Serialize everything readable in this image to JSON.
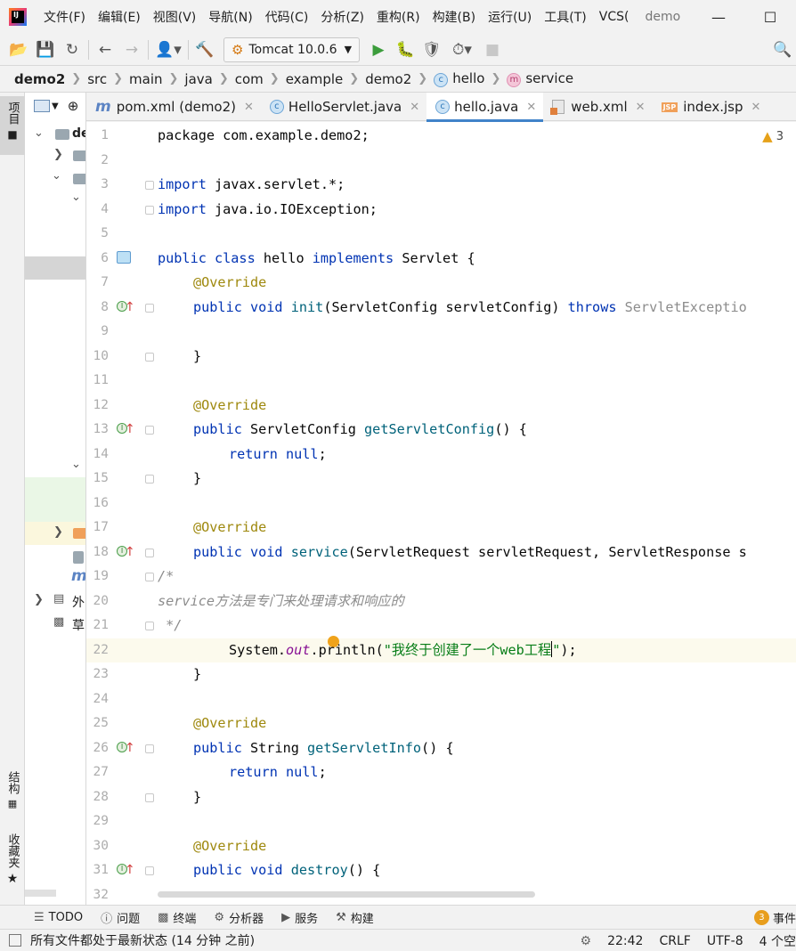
{
  "menu": {
    "items": [
      "文件(F)",
      "编辑(E)",
      "视图(V)",
      "导航(N)",
      "代码(C)",
      "分析(Z)",
      "重构(R)",
      "构建(B)",
      "运行(U)",
      "工具(T)",
      "VCS("
    ],
    "project_name": "demo",
    "minimize": "—",
    "maximize": "☐"
  },
  "toolbar": {
    "run_config": "Tomcat 10.0.6"
  },
  "breadcrumb": {
    "items": [
      "demo2",
      "src",
      "main",
      "java",
      "com",
      "example",
      "demo2",
      "hello",
      "service"
    ]
  },
  "left_strip": {
    "project_tab": "项目",
    "structure_tab": "结构",
    "favorites_tab": "收藏夹"
  },
  "project_panel": {
    "root_label": "de",
    "row_m": "m",
    "row_ext": "外",
    "row_scratch": "草"
  },
  "tabs": [
    {
      "label": "pom.xml (demo2)"
    },
    {
      "label": "HelloServlet.java"
    },
    {
      "label": "hello.java"
    },
    {
      "label": "web.xml"
    },
    {
      "label": "index.jsp"
    }
  ],
  "editor": {
    "warning_count": "3",
    "lines": {
      "l1": "package com.example.demo2;",
      "l3a": "import",
      "l3b": " javax.servlet.*;",
      "l4a": "import",
      "l4b": " java.io.IOException;",
      "l6a": "public class",
      "l6b": " hello ",
      "l6c": "implements",
      "l6d": " Servlet {",
      "ann": "@Override",
      "l8a": "public void ",
      "l8b": "init",
      "l8c": "(ServletConfig servletConfig) ",
      "l8d": "throws",
      "l8e": " ServletExceptio",
      "brace_close": "}",
      "l13a": "public",
      "l13b": " ServletConfig ",
      "l13c": "getServletConfig",
      "l13d": "() {",
      "l14a": "return null",
      "l14b": ";",
      "l18a": "public void ",
      "l18b": "service",
      "l18c": "(ServletRequest servletRequest, ServletResponse s",
      "l19": "/*",
      "l20": "service方法是专门来处理请求和响应的",
      "l21": " */",
      "l22a": "System.",
      "l22b": "out",
      "l22c": ".println(",
      "l22d": "\"我终于创建了一个web工程",
      "l22e": "\"",
      "l22f": ");",
      "l26a": "public",
      "l26b": " String ",
      "l26c": "getServletInfo",
      "l26d": "() {",
      "l31a": "public void ",
      "l31b": "destroy",
      "l31c": "() {"
    }
  },
  "bottom_tools": {
    "todo": "TODO",
    "problems": "问题",
    "terminal": "终端",
    "profiler": "分析器",
    "services": "服务",
    "build": "构建",
    "events_count": "3",
    "events": "事件"
  },
  "status": {
    "message": "所有文件都处于最新状态 (14 分钟 之前)",
    "position": "22:42",
    "line_sep": "CRLF",
    "encoding": "UTF-8",
    "indent": "4 个空"
  }
}
